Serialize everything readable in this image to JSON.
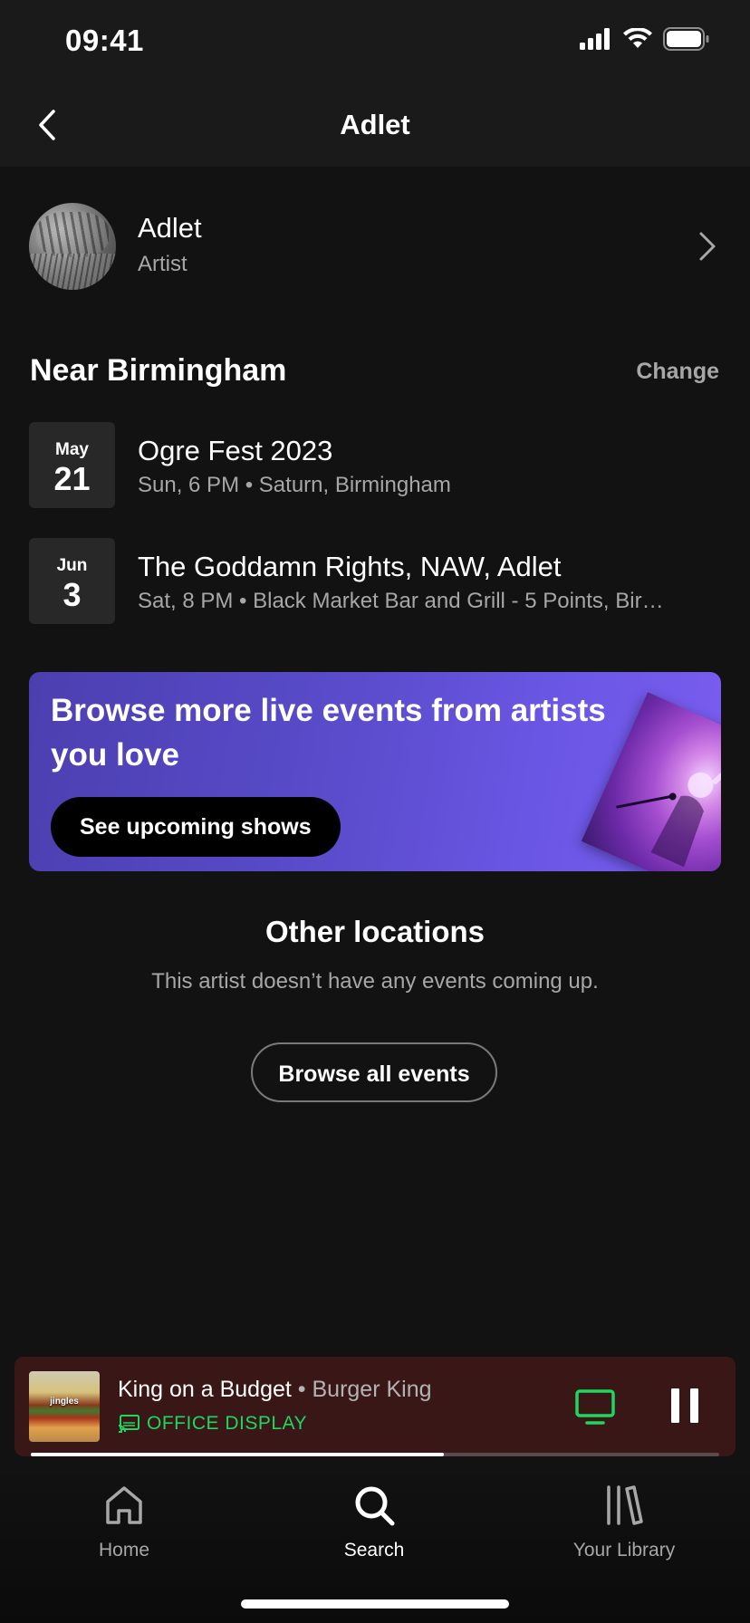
{
  "status_bar": {
    "time": "09:41"
  },
  "header": {
    "title": "Adlet"
  },
  "artist": {
    "name": "Adlet",
    "type": "Artist"
  },
  "near": {
    "title": "Near Birmingham",
    "change_label": "Change",
    "events": [
      {
        "month": "May",
        "day": "21",
        "title": "Ogre Fest 2023",
        "subtitle": "Sun, 6 PM • Saturn, Birmingham"
      },
      {
        "month": "Jun",
        "day": "3",
        "title": "The Goddamn Rights, NAW, Adlet",
        "subtitle": "Sat, 8 PM • Black Market Bar and Grill - 5 Points, Bir…"
      }
    ]
  },
  "promo": {
    "title": "Browse more live events from artists you love",
    "button_label": "See upcoming shows"
  },
  "other_locations": {
    "title": "Other locations",
    "message": "This artist doesn’t have any events coming up.",
    "button_label": "Browse all events"
  },
  "player": {
    "track": "King on a Budget",
    "separator": " • ",
    "artist": "Burger King",
    "device": "OFFICE DISPLAY",
    "album_art_text": "jingles",
    "progress_fraction": 0.6,
    "device_color": "#1ed760"
  },
  "bottom_nav": {
    "items": [
      {
        "label": "Home",
        "icon": "home-icon",
        "active": false
      },
      {
        "label": "Search",
        "icon": "search-icon",
        "active": true
      },
      {
        "label": "Your Library",
        "icon": "library-icon",
        "active": false
      }
    ]
  }
}
